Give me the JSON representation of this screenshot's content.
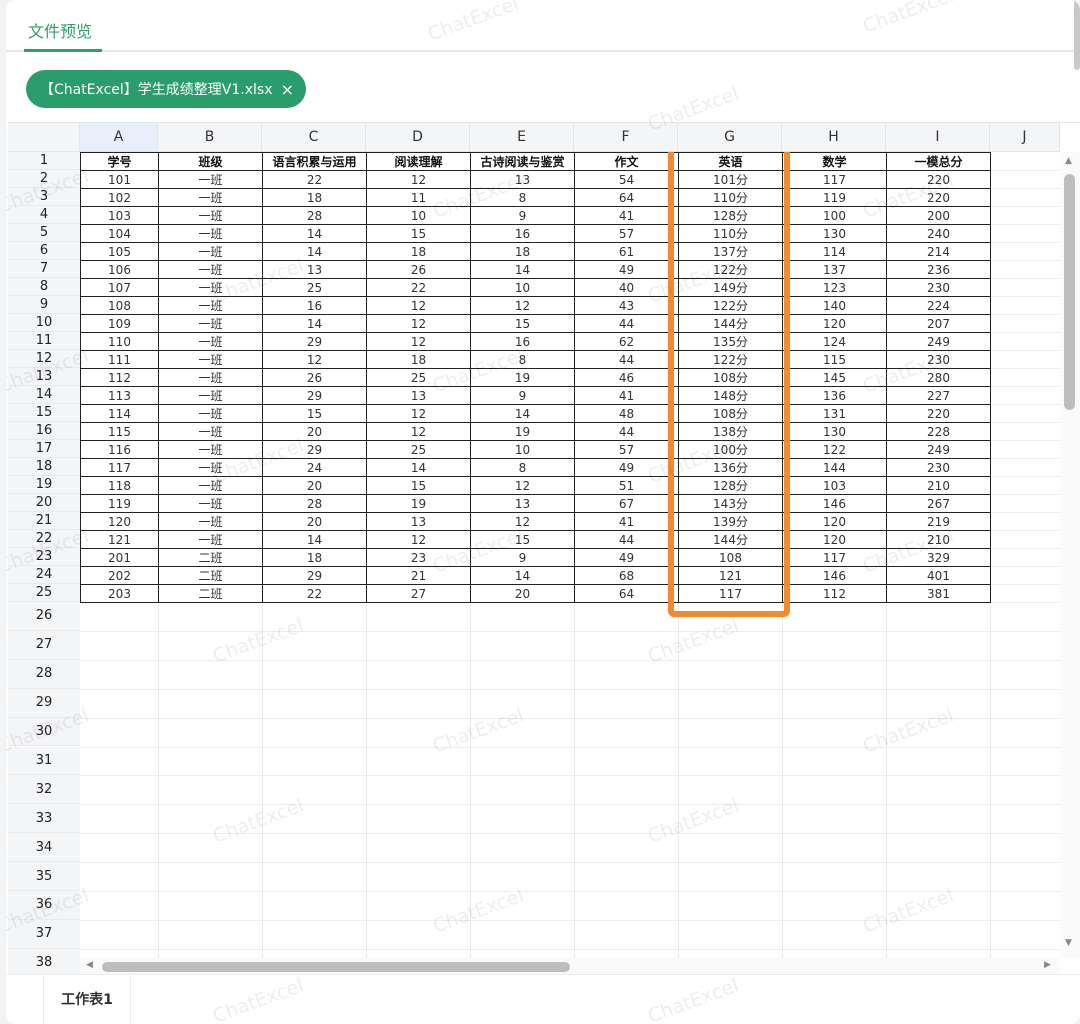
{
  "tabs": [
    {
      "label": "文件预览"
    }
  ],
  "file_chip": {
    "name": "【ChatExcel】学生成绩整理V1.xlsx",
    "close": "×"
  },
  "column_letters": [
    "A",
    "B",
    "C",
    "D",
    "E",
    "F",
    "G",
    "H",
    "I",
    "J"
  ],
  "row_numbers": [
    "1",
    "2",
    "3",
    "4",
    "5",
    "6",
    "7",
    "8",
    "9",
    "10",
    "11",
    "12",
    "13",
    "14",
    "15",
    "16",
    "17",
    "18",
    "19",
    "20",
    "21",
    "22",
    "23",
    "24",
    "25",
    "26",
    "27",
    "28",
    "29",
    "30",
    "31",
    "32",
    "33",
    "34",
    "35",
    "36",
    "37",
    "38"
  ],
  "headers": [
    "学号",
    "班级",
    "语言积累与运用",
    "阅读理解",
    "古诗阅读与鉴赏",
    "作文",
    "英语",
    "数学",
    "一模总分"
  ],
  "rows": [
    [
      "101",
      "一班",
      "22",
      "12",
      "13",
      "54",
      "101分",
      "117",
      "220"
    ],
    [
      "102",
      "一班",
      "18",
      "11",
      "8",
      "64",
      "110分",
      "119",
      "220"
    ],
    [
      "103",
      "一班",
      "28",
      "10",
      "9",
      "41",
      "128分",
      "100",
      "200"
    ],
    [
      "104",
      "一班",
      "14",
      "15",
      "16",
      "57",
      "110分",
      "130",
      "240"
    ],
    [
      "105",
      "一班",
      "14",
      "18",
      "18",
      "61",
      "137分",
      "114",
      "214"
    ],
    [
      "106",
      "一班",
      "13",
      "26",
      "14",
      "49",
      "122分",
      "137",
      "236"
    ],
    [
      "107",
      "一班",
      "25",
      "22",
      "10",
      "40",
      "149分",
      "123",
      "230"
    ],
    [
      "108",
      "一班",
      "16",
      "12",
      "12",
      "43",
      "122分",
      "140",
      "224"
    ],
    [
      "109",
      "一班",
      "14",
      "12",
      "15",
      "44",
      "144分",
      "120",
      "207"
    ],
    [
      "110",
      "一班",
      "29",
      "12",
      "16",
      "62",
      "135分",
      "124",
      "249"
    ],
    [
      "111",
      "一班",
      "12",
      "18",
      "8",
      "44",
      "122分",
      "115",
      "230"
    ],
    [
      "112",
      "一班",
      "26",
      "25",
      "19",
      "46",
      "108分",
      "145",
      "280"
    ],
    [
      "113",
      "一班",
      "29",
      "13",
      "9",
      "41",
      "148分",
      "136",
      "227"
    ],
    [
      "114",
      "一班",
      "15",
      "12",
      "14",
      "48",
      "108分",
      "131",
      "220"
    ],
    [
      "115",
      "一班",
      "20",
      "12",
      "19",
      "44",
      "138分",
      "130",
      "228"
    ],
    [
      "116",
      "一班",
      "29",
      "25",
      "10",
      "57",
      "100分",
      "122",
      "249"
    ],
    [
      "117",
      "一班",
      "24",
      "14",
      "8",
      "49",
      "136分",
      "144",
      "230"
    ],
    [
      "118",
      "一班",
      "20",
      "15",
      "12",
      "51",
      "128分",
      "103",
      "210"
    ],
    [
      "119",
      "一班",
      "28",
      "19",
      "13",
      "67",
      "143分",
      "146",
      "267"
    ],
    [
      "120",
      "一班",
      "20",
      "13",
      "12",
      "41",
      "139分",
      "120",
      "219"
    ],
    [
      "121",
      "一班",
      "14",
      "12",
      "15",
      "44",
      "144分",
      "120",
      "210"
    ],
    [
      "201",
      "二班",
      "18",
      "23",
      "9",
      "49",
      "108",
      "117",
      "329"
    ],
    [
      "202",
      "二班",
      "29",
      "21",
      "14",
      "68",
      "121",
      "146",
      "401"
    ],
    [
      "203",
      "二班",
      "22",
      "27",
      "20",
      "64",
      "117",
      "112",
      "381"
    ]
  ],
  "highlight_color": "#f5892e",
  "sheet_tabs": [
    {
      "label": "工作表1"
    }
  ],
  "watermark": "ChatExcel",
  "icons": {
    "scroll_up": "▲",
    "scroll_down": "▼",
    "scroll_left": "◀",
    "scroll_right": "▶"
  }
}
